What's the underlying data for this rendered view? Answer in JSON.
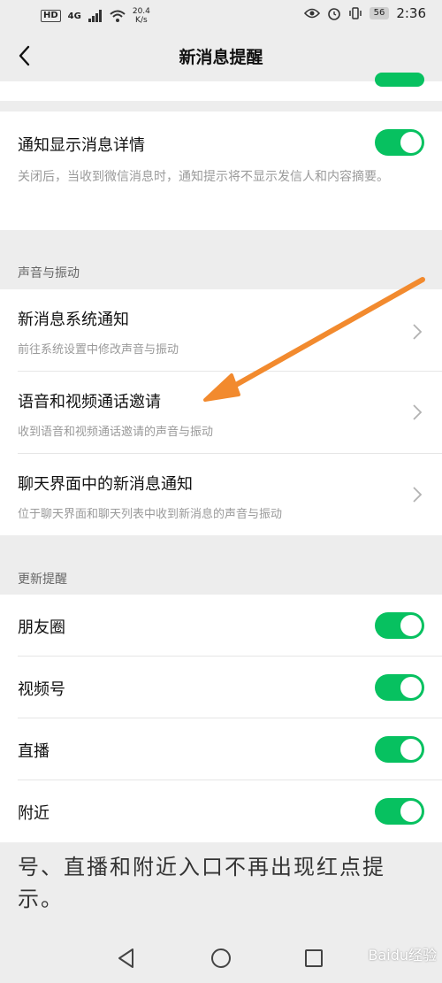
{
  "status_bar": {
    "hd": "HD",
    "net": "4G",
    "speed_value": "20.4",
    "speed_unit": "K/s",
    "battery": "56",
    "time": "2:36"
  },
  "nav": {
    "title": "新消息提醒"
  },
  "notify_detail": {
    "title": "通知显示消息详情",
    "desc": "关闭后，当收到微信消息时，通知提示将不显示发信人和内容摘要。",
    "enabled": true
  },
  "sound_section": {
    "header": "声音与振动",
    "items": [
      {
        "title": "新消息系统通知",
        "sub": "前往系统设置中修改声音与振动"
      },
      {
        "title": "语音和视频通话邀请",
        "sub": "收到语音和视频通话邀请的声音与振动"
      },
      {
        "title": "聊天界面中的新消息通知",
        "sub": "位于聊天界面和聊天列表中收到新消息的声音与振动"
      }
    ]
  },
  "update_section": {
    "header": "更新提醒",
    "items": [
      {
        "title": "朋友圈",
        "enabled": true
      },
      {
        "title": "视频号",
        "enabled": true
      },
      {
        "title": "直播",
        "enabled": true
      },
      {
        "title": "附近",
        "enabled": true
      }
    ]
  },
  "bottom_caption": "号、直播和附近入口不再出现红点提示。",
  "watermark": "Baidu经验",
  "colors": {
    "accent": "#07c160",
    "annotation_arrow": "#f28a2e",
    "background": "#ededed"
  }
}
